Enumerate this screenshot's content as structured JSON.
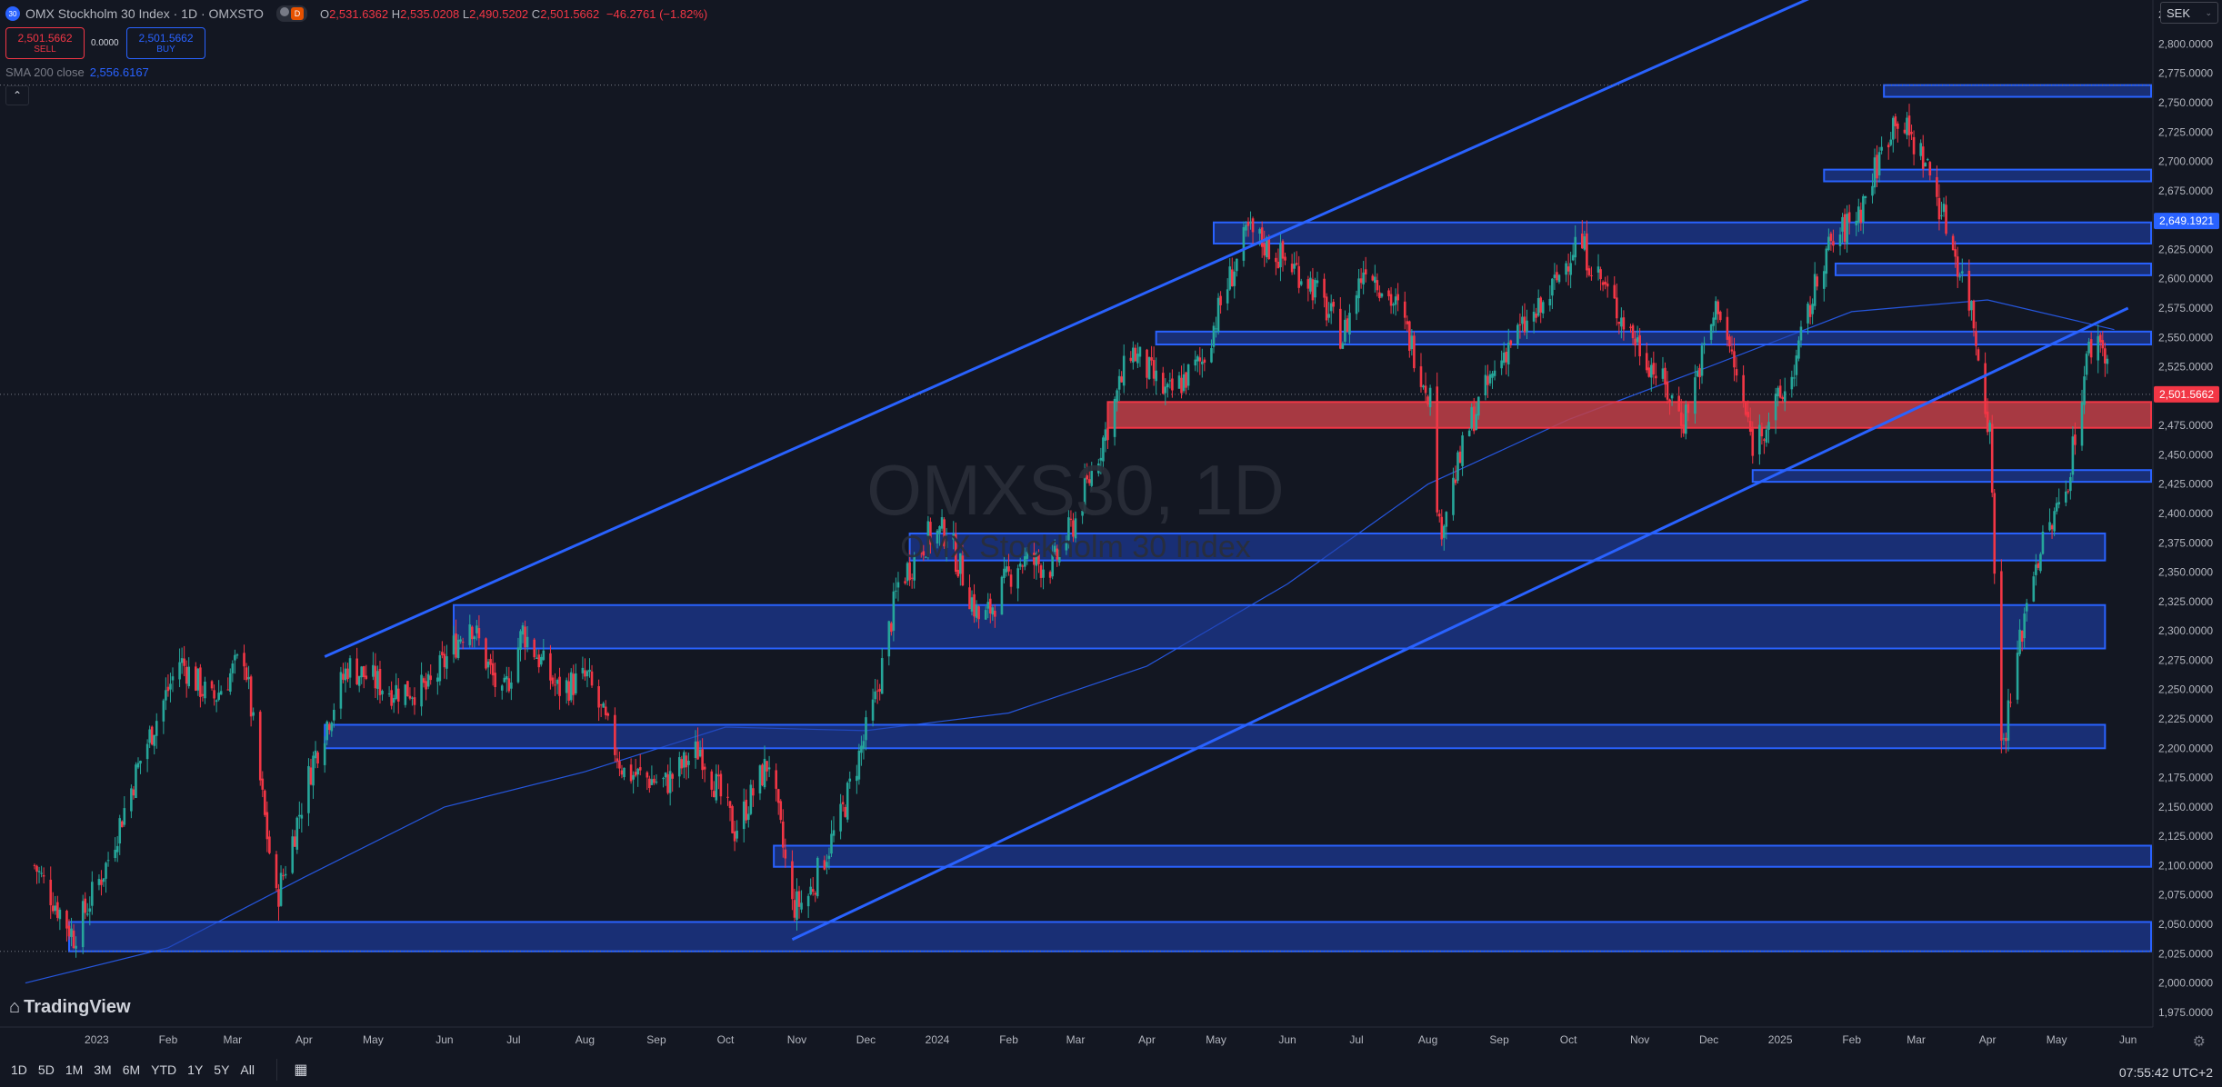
{
  "header": {
    "symbol_badge": "30",
    "title": "OMX Stockholm 30 Index · 1D · OMXSTO",
    "live_badge": "D",
    "ohlc": {
      "o_label": "O",
      "o": "2,531.6362",
      "h_label": "H",
      "h": "2,535.0208",
      "l_label": "L",
      "l": "2,490.5202",
      "c_label": "C",
      "c": "2,501.5662",
      "change": "−46.2761 (−1.82%)"
    }
  },
  "trade": {
    "sell_price": "2,501.5662",
    "sell_label": "SELL",
    "spread": "0.0000",
    "buy_price": "2,501.5662",
    "buy_label": "BUY"
  },
  "indicator": {
    "label": "SMA 200 close",
    "value": "2,556.6167"
  },
  "currency": {
    "value": "SEK"
  },
  "watermark": {
    "symbol": "OMXS30, 1D",
    "name": "OMX Stockholm 30 Index"
  },
  "branding": {
    "name": "TradingView"
  },
  "time_ranges": [
    "1D",
    "5D",
    "1M",
    "3M",
    "6M",
    "YTD",
    "1Y",
    "5Y",
    "All"
  ],
  "clock": "07:55:42 UTC+2",
  "colors": {
    "up": "#26a69a",
    "down": "#f23645",
    "accent": "#2962ff",
    "zone_fill": "#1e3fae",
    "zone_red": "#c24048",
    "background": "#131722"
  },
  "chart_data": {
    "type": "candlestick",
    "title": "OMXS30, 1D",
    "subtitle": "OMX Stockholm 30 Index",
    "ylim": [
      1962.5,
      2837.5
    ],
    "yticks": [
      "2,825.0000",
      "2,800.0000",
      "2,775.0000",
      "2,750.0000",
      "2,725.0000",
      "2,700.0000",
      "2,675.0000",
      "2,650.0000",
      "2,625.0000",
      "2,600.0000",
      "2,575.0000",
      "2,550.0000",
      "2,525.0000",
      "2,500.0000",
      "2,475.0000",
      "2,450.0000",
      "2,425.0000",
      "2,400.0000",
      "2,375.0000",
      "2,350.0000",
      "2,325.0000",
      "2,300.0000",
      "2,275.0000",
      "2,250.0000",
      "2,225.0000",
      "2,200.0000",
      "2,175.0000",
      "2,150.0000",
      "2,125.0000",
      "2,100.0000",
      "2,075.0000",
      "2,050.0000",
      "2,025.0000",
      "2,000.0000",
      "1,975.0000"
    ],
    "xticks": [
      "2023",
      "Feb",
      "Mar",
      "Apr",
      "May",
      "Jun",
      "Jul",
      "Aug",
      "Sep",
      "Oct",
      "Nov",
      "Dec",
      "2024",
      "Feb",
      "Mar",
      "Apr",
      "May",
      "Jun",
      "Jul",
      "Aug",
      "Sep",
      "Oct",
      "Nov",
      "Dec",
      "2025",
      "Feb",
      "Mar",
      "Apr",
      "May",
      "Jun"
    ],
    "xtick_dates": [
      "2023-01-01",
      "2023-02-01",
      "2023-03-01",
      "2023-04-01",
      "2023-05-01",
      "2023-06-01",
      "2023-07-01",
      "2023-08-01",
      "2023-09-01",
      "2023-10-01",
      "2023-11-01",
      "2023-12-01",
      "2024-01-01",
      "2024-02-01",
      "2024-03-01",
      "2024-04-01",
      "2024-05-01",
      "2024-06-01",
      "2024-07-01",
      "2024-08-01",
      "2024-09-01",
      "2024-10-01",
      "2024-11-01",
      "2024-12-01",
      "2025-01-01",
      "2025-02-01",
      "2025-03-01",
      "2025-04-01",
      "2025-05-01",
      "2025-06-01"
    ],
    "last_price_label": "2,501.5662",
    "level_label": "2,649.1921",
    "key_points": [
      {
        "date": "2022-12-05",
        "close": 2100
      },
      {
        "date": "2022-12-22",
        "close": 2040
      },
      {
        "date": "2023-01-05",
        "close": 2100
      },
      {
        "date": "2023-01-20",
        "close": 2190
      },
      {
        "date": "2023-02-06",
        "close": 2275
      },
      {
        "date": "2023-02-20",
        "close": 2240
      },
      {
        "date": "2023-03-06",
        "close": 2280
      },
      {
        "date": "2023-03-15",
        "close": 2140
      },
      {
        "date": "2023-03-20",
        "close": 2070
      },
      {
        "date": "2023-04-05",
        "close": 2190
      },
      {
        "date": "2023-04-20",
        "close": 2270
      },
      {
        "date": "2023-05-08",
        "close": 2250
      },
      {
        "date": "2023-05-25",
        "close": 2250
      },
      {
        "date": "2023-06-12",
        "close": 2310
      },
      {
        "date": "2023-06-26",
        "close": 2240
      },
      {
        "date": "2023-07-05",
        "close": 2300
      },
      {
        "date": "2023-07-20",
        "close": 2250
      },
      {
        "date": "2023-08-02",
        "close": 2260
      },
      {
        "date": "2023-08-18",
        "close": 2180
      },
      {
        "date": "2023-09-05",
        "close": 2170
      },
      {
        "date": "2023-09-20",
        "close": 2200
      },
      {
        "date": "2023-10-05",
        "close": 2130
      },
      {
        "date": "2023-10-20",
        "close": 2190
      },
      {
        "date": "2023-10-30",
        "close": 2065
      },
      {
        "date": "2023-11-05",
        "close": 2070
      },
      {
        "date": "2023-11-20",
        "close": 2140
      },
      {
        "date": "2023-12-05",
        "close": 2240
      },
      {
        "date": "2023-12-15",
        "close": 2340
      },
      {
        "date": "2023-12-28",
        "close": 2380
      },
      {
        "date": "2024-01-05",
        "close": 2385
      },
      {
        "date": "2024-01-20",
        "close": 2305
      },
      {
        "date": "2024-02-05",
        "close": 2360
      },
      {
        "date": "2024-02-20",
        "close": 2355
      },
      {
        "date": "2024-03-01",
        "close": 2395
      },
      {
        "date": "2024-03-15",
        "close": 2475
      },
      {
        "date": "2024-03-25",
        "close": 2540
      },
      {
        "date": "2024-04-10",
        "close": 2500
      },
      {
        "date": "2024-04-25",
        "close": 2530
      },
      {
        "date": "2024-05-05",
        "close": 2590
      },
      {
        "date": "2024-05-15",
        "close": 2640
      },
      {
        "date": "2024-05-28",
        "close": 2620
      },
      {
        "date": "2024-06-10",
        "close": 2600
      },
      {
        "date": "2024-06-25",
        "close": 2550
      },
      {
        "date": "2024-07-05",
        "close": 2615
      },
      {
        "date": "2024-07-20",
        "close": 2570
      },
      {
        "date": "2024-08-02",
        "close": 2500
      },
      {
        "date": "2024-08-06",
        "close": 2385
      },
      {
        "date": "2024-08-20",
        "close": 2480
      },
      {
        "date": "2024-09-05",
        "close": 2545
      },
      {
        "date": "2024-09-20",
        "close": 2575
      },
      {
        "date": "2024-10-05",
        "close": 2635
      },
      {
        "date": "2024-10-20",
        "close": 2580
      },
      {
        "date": "2024-11-05",
        "close": 2530
      },
      {
        "date": "2024-11-20",
        "close": 2480
      },
      {
        "date": "2024-12-05",
        "close": 2580
      },
      {
        "date": "2024-12-20",
        "close": 2460
      },
      {
        "date": "2025-01-05",
        "close": 2510
      },
      {
        "date": "2025-01-20",
        "close": 2620
      },
      {
        "date": "2025-02-05",
        "close": 2660
      },
      {
        "date": "2025-02-20",
        "close": 2740
      },
      {
        "date": "2025-03-05",
        "close": 2700
      },
      {
        "date": "2025-03-15",
        "close": 2640
      },
      {
        "date": "2025-03-25",
        "close": 2575
      },
      {
        "date": "2025-04-02",
        "close": 2470
      },
      {
        "date": "2025-04-07",
        "close": 2200
      },
      {
        "date": "2025-04-10",
        "close": 2230
      },
      {
        "date": "2025-04-20",
        "close": 2350
      },
      {
        "date": "2025-05-05",
        "close": 2420
      },
      {
        "date": "2025-05-15",
        "close": 2540
      },
      {
        "date": "2025-05-20",
        "close": 2550
      },
      {
        "date": "2025-05-26",
        "close": 2501.57
      }
    ],
    "sma200": [
      {
        "date": "2022-12-01",
        "value": 2000
      },
      {
        "date": "2023-02-01",
        "value": 2030
      },
      {
        "date": "2023-04-01",
        "value": 2090
      },
      {
        "date": "2023-06-01",
        "value": 2150
      },
      {
        "date": "2023-08-01",
        "value": 2180
      },
      {
        "date": "2023-10-01",
        "value": 2218
      },
      {
        "date": "2023-12-01",
        "value": 2215
      },
      {
        "date": "2024-02-01",
        "value": 2230
      },
      {
        "date": "2024-04-01",
        "value": 2270
      },
      {
        "date": "2024-06-01",
        "value": 2340
      },
      {
        "date": "2024-08-01",
        "value": 2425
      },
      {
        "date": "2024-10-01",
        "value": 2480
      },
      {
        "date": "2024-12-01",
        "value": 2525
      },
      {
        "date": "2025-02-01",
        "value": 2572
      },
      {
        "date": "2025-04-01",
        "value": 2582
      },
      {
        "date": "2025-05-26",
        "value": 2556.62
      }
    ],
    "zones": [
      {
        "from": "2022-12-20",
        "to": "2025-06-30",
        "low": 2027,
        "high": 2052,
        "color": "blue"
      },
      {
        "from": "2023-10-22",
        "to": "2025-06-30",
        "low": 2099,
        "high": 2117,
        "color": "blue"
      },
      {
        "from": "2023-04-10",
        "to": "2025-05-22",
        "low": 2200,
        "high": 2220,
        "color": "blue"
      },
      {
        "from": "2023-06-05",
        "to": "2025-05-22",
        "low": 2285,
        "high": 2322,
        "color": "blue"
      },
      {
        "from": "2023-12-20",
        "to": "2025-05-22",
        "low": 2360,
        "high": 2383,
        "color": "blue"
      },
      {
        "from": "2024-12-20",
        "to": "2025-06-30",
        "low": 2427,
        "high": 2437,
        "color": "blue"
      },
      {
        "from": "2024-03-15",
        "to": "2025-06-30",
        "low": 2473,
        "high": 2495,
        "color": "red"
      },
      {
        "from": "2024-04-05",
        "to": "2025-06-30",
        "low": 2544,
        "high": 2555,
        "color": "blue"
      },
      {
        "from": "2025-01-25",
        "to": "2025-06-30",
        "low": 2603,
        "high": 2613,
        "color": "blue"
      },
      {
        "from": "2024-04-30",
        "to": "2025-06-30",
        "low": 2630,
        "high": 2648,
        "color": "blue"
      },
      {
        "from": "2025-01-20",
        "to": "2025-06-30",
        "low": 2683,
        "high": 2693,
        "color": "blue"
      },
      {
        "from": "2025-02-15",
        "to": "2025-06-30",
        "low": 2755,
        "high": 2765,
        "color": "blue"
      }
    ],
    "trendlines": [
      {
        "from": {
          "date": "2023-04-10",
          "value": 2278
        },
        "to": {
          "date": "2025-01-15",
          "value": 2840
        }
      },
      {
        "from": {
          "date": "2023-10-30",
          "value": 2037
        },
        "to": {
          "date": "2025-06-01",
          "value": 2575
        }
      }
    ],
    "hlines": [
      {
        "value": 2765,
        "style": "dotted"
      },
      {
        "value": 2501.57,
        "style": "dotted"
      },
      {
        "value": 2027,
        "style": "dotted"
      }
    ]
  }
}
